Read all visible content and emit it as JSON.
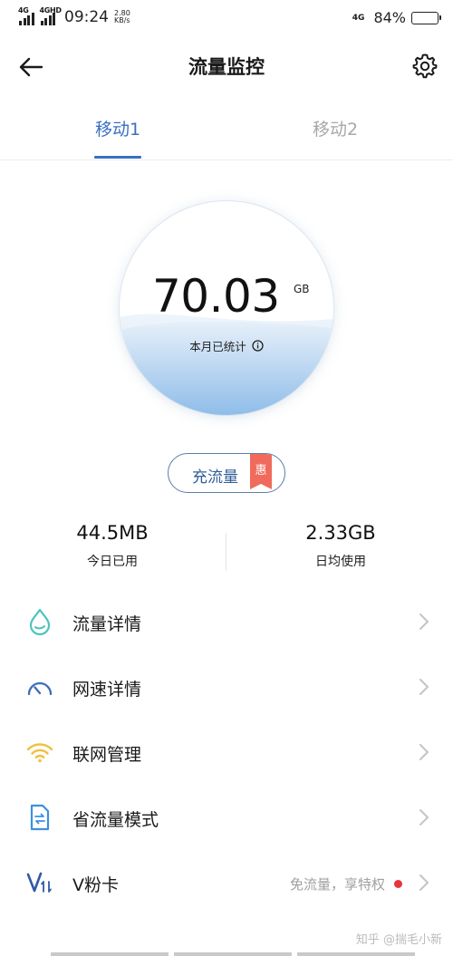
{
  "status_bar": {
    "sim1_net": "4G",
    "sim2_net": "4GHD",
    "time": "09:24",
    "speed_value": "2.80",
    "speed_unit": "KB/s",
    "right_net": "4G",
    "battery_text": "84%",
    "battery_level": 0.84
  },
  "header": {
    "title": "流量监控",
    "back_icon": "arrow-left-icon",
    "settings_icon": "gear-icon"
  },
  "tabs": [
    {
      "label": "移动1",
      "active": true
    },
    {
      "label": "移动2",
      "active": false
    }
  ],
  "usage": {
    "value": "70.03",
    "unit": "GB",
    "caption": "本月已统计",
    "info_icon": "info-icon"
  },
  "recharge": {
    "label": "充流量",
    "badge": "惠"
  },
  "stats": {
    "today": {
      "value": "44.5MB",
      "label": "今日已用"
    },
    "daily_avg": {
      "value": "2.33GB",
      "label": "日均使用"
    }
  },
  "menu": [
    {
      "label": "流量详情",
      "icon": "droplet-icon"
    },
    {
      "label": "网速详情",
      "icon": "speedometer-icon"
    },
    {
      "label": "联网管理",
      "icon": "wifi-icon"
    },
    {
      "label": "省流量模式",
      "icon": "data-saver-file-icon"
    },
    {
      "label": "V粉卡",
      "icon": "vfan-card-icon",
      "hint": "免流量，享特权"
    }
  ],
  "watermark": "知乎 @揣毛小新",
  "colors": {
    "accent": "#3a6fc4",
    "badge": "#f06b5c",
    "water": "#9cc7ee",
    "red_dot": "#e8343b"
  }
}
